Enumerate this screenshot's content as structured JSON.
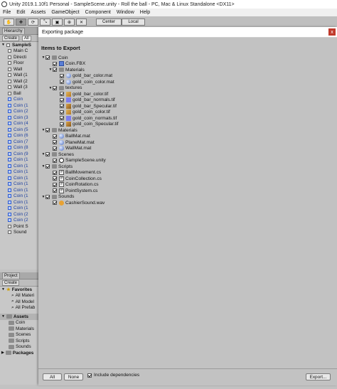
{
  "window": {
    "title": "Unity 2019.1.10f1 Personal - SampleScene.unity - Roll the ball - PC, Mac & Linux Standalone <DX11>"
  },
  "menu": [
    "File",
    "Edit",
    "Assets",
    "GameObject",
    "Component",
    "Window",
    "Help"
  ],
  "toolbar": {
    "pivot_label": "Center",
    "space_label": "Local"
  },
  "hierarchy": {
    "tab_label": "Hierarchy",
    "create_label": "Create",
    "search_placeholder": "All",
    "scene": "SampleS",
    "items": [
      {
        "label": "Main C",
        "blue": false
      },
      {
        "label": "Directi",
        "blue": false
      },
      {
        "label": "Floor",
        "blue": false
      },
      {
        "label": "Wall",
        "blue": false
      },
      {
        "label": "Wall (1",
        "blue": false
      },
      {
        "label": "Wall (2",
        "blue": false
      },
      {
        "label": "Wall (3",
        "blue": false
      },
      {
        "label": "Ball",
        "blue": false
      },
      {
        "label": "Coin",
        "blue": true
      },
      {
        "label": "Coin (1",
        "blue": true
      },
      {
        "label": "Coin (2",
        "blue": true
      },
      {
        "label": "Coin (3",
        "blue": true
      },
      {
        "label": "Coin (4",
        "blue": true
      },
      {
        "label": "Coin (5",
        "blue": true
      },
      {
        "label": "Coin (6",
        "blue": true
      },
      {
        "label": "Coin (7",
        "blue": true
      },
      {
        "label": "Coin (8",
        "blue": true
      },
      {
        "label": "Coin (9",
        "blue": true
      },
      {
        "label": "Coin (1",
        "blue": true
      },
      {
        "label": "Coin (1",
        "blue": true
      },
      {
        "label": "Coin (1",
        "blue": true
      },
      {
        "label": "Coin (1",
        "blue": true
      },
      {
        "label": "Coin (1",
        "blue": true
      },
      {
        "label": "Coin (1",
        "blue": true
      },
      {
        "label": "Coin (1",
        "blue": true
      },
      {
        "label": "Coin (1",
        "blue": true
      },
      {
        "label": "Coin (1",
        "blue": true
      },
      {
        "label": "Coin (2",
        "blue": true
      },
      {
        "label": "Coin (2",
        "blue": true
      },
      {
        "label": "Point S",
        "blue": false
      },
      {
        "label": "Sound",
        "blue": false
      }
    ]
  },
  "project": {
    "tab_label": "Project",
    "create_label": "Create",
    "favorites_label": "Favorites",
    "favorites": [
      "All Materi",
      "All Model",
      "All Prefab"
    ],
    "assets_label": "Assets",
    "assets": [
      "Coin",
      "Materials",
      "Scenes",
      "Scripts",
      "Sounds"
    ],
    "packages_label": "Packages"
  },
  "dialog": {
    "title": "Exporting package",
    "close_glyph": "x",
    "heading": "Items to Export",
    "tree": [
      {
        "label": "Coin",
        "depth": 1,
        "icon": "folder",
        "fold": true
      },
      {
        "label": "Coin.FBX",
        "depth": 2,
        "icon": "fbx",
        "fold": false
      },
      {
        "label": "Materials",
        "depth": 2,
        "icon": "folder",
        "fold": true
      },
      {
        "label": "gold_bar_color.mat",
        "depth": 3,
        "icon": "mat",
        "fold": false
      },
      {
        "label": "gold_coin_color.mat",
        "depth": 3,
        "icon": "mat",
        "fold": false
      },
      {
        "label": "textures",
        "depth": 2,
        "icon": "folder",
        "fold": true
      },
      {
        "label": "gold_bar_color.tif",
        "depth": 3,
        "icon": "tif-color",
        "fold": false
      },
      {
        "label": "gold_bar_normals.tif",
        "depth": 3,
        "icon": "tif-norm",
        "fold": false
      },
      {
        "label": "gold_bar_Specular.tif",
        "depth": 3,
        "icon": "tif",
        "fold": false
      },
      {
        "label": "gold_coin_color.tif",
        "depth": 3,
        "icon": "tif-color",
        "fold": false
      },
      {
        "label": "gold_coin_normals.tif",
        "depth": 3,
        "icon": "tif-norm",
        "fold": false
      },
      {
        "label": "gold_coin_Specular.tif",
        "depth": 3,
        "icon": "tif",
        "fold": false
      },
      {
        "label": "Materials",
        "depth": 1,
        "icon": "folder",
        "fold": true
      },
      {
        "label": "BallMat.mat",
        "depth": 2,
        "icon": "mat",
        "fold": false
      },
      {
        "label": "PlaneMat.mat",
        "depth": 2,
        "icon": "mat",
        "fold": false
      },
      {
        "label": "WallMat.mat",
        "depth": 2,
        "icon": "mat",
        "fold": false
      },
      {
        "label": "Scenes",
        "depth": 1,
        "icon": "folder",
        "fold": true
      },
      {
        "label": "SampleScene.unity",
        "depth": 2,
        "icon": "unity",
        "fold": false
      },
      {
        "label": "Scripts",
        "depth": 1,
        "icon": "folder",
        "fold": true
      },
      {
        "label": "BallMovement.cs",
        "depth": 2,
        "icon": "cs",
        "fold": false
      },
      {
        "label": "CoinCollection.cs",
        "depth": 2,
        "icon": "cs",
        "fold": false
      },
      {
        "label": "CoinRotation.cs",
        "depth": 2,
        "icon": "cs",
        "fold": false
      },
      {
        "label": "PointSystem.cs",
        "depth": 2,
        "icon": "cs",
        "fold": false
      },
      {
        "label": "Sounds",
        "depth": 1,
        "icon": "folder",
        "fold": true
      },
      {
        "label": "CashierSound.wav",
        "depth": 2,
        "icon": "wav",
        "fold": false
      }
    ],
    "all_label": "All",
    "none_label": "None",
    "include_deps_label": "Include dependencies",
    "include_deps_checked": true,
    "export_label": "Export..."
  }
}
